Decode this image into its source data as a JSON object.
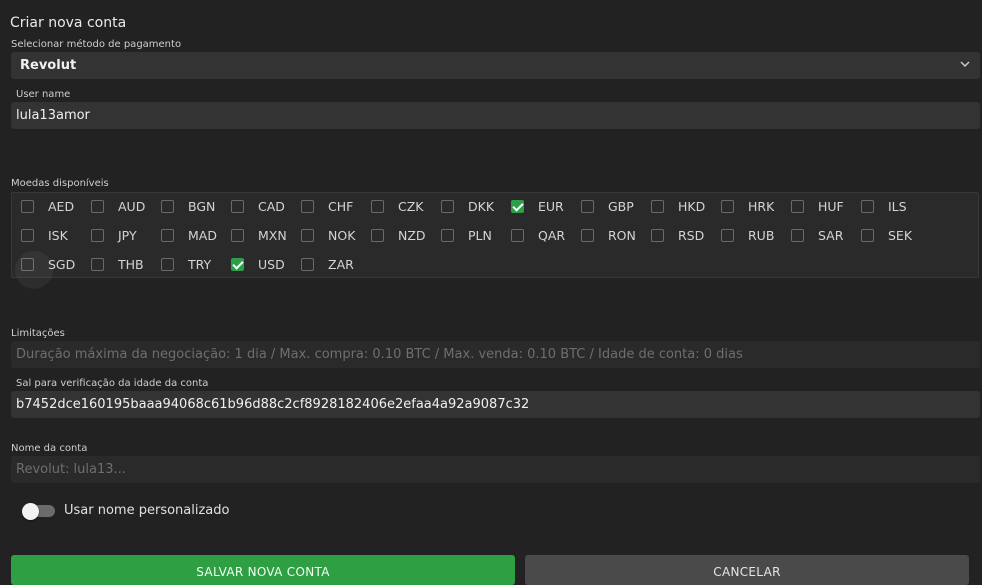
{
  "title": "Criar nova conta",
  "payment": {
    "label": "Selecionar método de pagamento",
    "value": "Revolut"
  },
  "username": {
    "label": "User name",
    "value": "lula13amor"
  },
  "currencies": {
    "label": "Moedas disponíveis",
    "items": [
      {
        "code": "AED",
        "checked": false
      },
      {
        "code": "AUD",
        "checked": false
      },
      {
        "code": "BGN",
        "checked": false
      },
      {
        "code": "CAD",
        "checked": false
      },
      {
        "code": "CHF",
        "checked": false
      },
      {
        "code": "CZK",
        "checked": false
      },
      {
        "code": "DKK",
        "checked": false
      },
      {
        "code": "EUR",
        "checked": true
      },
      {
        "code": "GBP",
        "checked": false
      },
      {
        "code": "HKD",
        "checked": false
      },
      {
        "code": "HRK",
        "checked": false
      },
      {
        "code": "HUF",
        "checked": false
      },
      {
        "code": "ILS",
        "checked": false
      },
      {
        "code": "ISK",
        "checked": false
      },
      {
        "code": "JPY",
        "checked": false
      },
      {
        "code": "MAD",
        "checked": false
      },
      {
        "code": "MXN",
        "checked": false
      },
      {
        "code": "NOK",
        "checked": false
      },
      {
        "code": "NZD",
        "checked": false
      },
      {
        "code": "PLN",
        "checked": false
      },
      {
        "code": "QAR",
        "checked": false
      },
      {
        "code": "RON",
        "checked": false
      },
      {
        "code": "RSD",
        "checked": false
      },
      {
        "code": "RUB",
        "checked": false
      },
      {
        "code": "SAR",
        "checked": false
      },
      {
        "code": "SEK",
        "checked": false
      },
      {
        "code": "SGD",
        "checked": false
      },
      {
        "code": "THB",
        "checked": false
      },
      {
        "code": "TRY",
        "checked": false
      },
      {
        "code": "USD",
        "checked": true
      },
      {
        "code": "ZAR",
        "checked": false
      }
    ]
  },
  "limits": {
    "label": "Limitações",
    "value": "Duração máxima da negociação: 1 dia / Max. compra: 0.10 BTC / Max. venda: 0.10 BTC / Idade de conta: 0 dias"
  },
  "salt": {
    "label": "Sal para verificação da idade da conta",
    "value": "b7452dce160195baaa94068c61b96d88c2cf8928182406e2efaa4a92a9087c32"
  },
  "account_name": {
    "label": "Nome da conta",
    "placeholder": "Revolut: lula13..."
  },
  "custom_name": {
    "label": "Usar nome personalizado",
    "enabled": false
  },
  "buttons": {
    "save": "SALVAR NOVA CONTA",
    "cancel": "CANCELAR"
  },
  "colors": {
    "accent": "#2ea043",
    "background": "#222222"
  }
}
